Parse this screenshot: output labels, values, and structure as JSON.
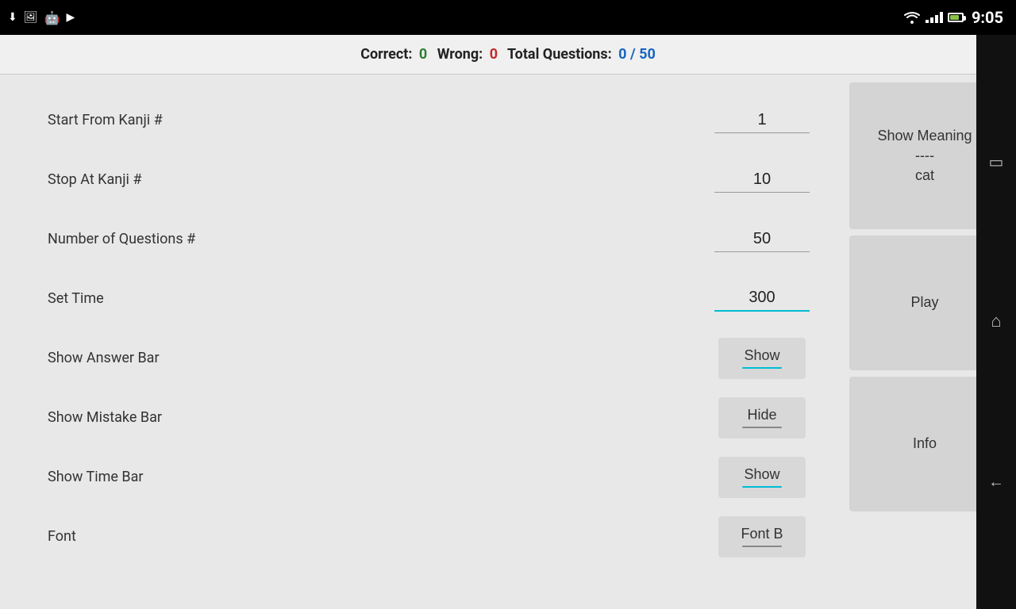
{
  "statusBar": {
    "time": "9:05",
    "icons": [
      "download",
      "image",
      "android",
      "play"
    ]
  },
  "scoreBar": {
    "label_correct": "Correct:",
    "value_correct": "0",
    "label_wrong": "Wrong:",
    "value_wrong": "0",
    "label_total": "Total Questions:",
    "value_total": "0 / 50"
  },
  "form": {
    "rows": [
      {
        "id": "start-kanji",
        "label": "Start From Kanji #",
        "type": "text",
        "value": "1",
        "active": false
      },
      {
        "id": "stop-kanji",
        "label": "Stop At Kanji #",
        "type": "text",
        "value": "10",
        "active": false
      },
      {
        "id": "num-questions",
        "label": "Number of Questions #",
        "type": "text",
        "value": "50",
        "active": false
      },
      {
        "id": "set-time",
        "label": "Set Time",
        "type": "text",
        "value": "300",
        "active": true
      },
      {
        "id": "show-answer",
        "label": "Show Answer Bar",
        "type": "toggle",
        "value": "Show",
        "underline": "blue"
      },
      {
        "id": "show-mistake",
        "label": "Show Mistake Bar",
        "type": "toggle",
        "value": "Hide",
        "underline": "gray"
      },
      {
        "id": "show-time",
        "label": "Show Time Bar",
        "type": "toggle",
        "value": "Show",
        "underline": "blue"
      },
      {
        "id": "font",
        "label": "Font",
        "type": "toggle",
        "value": "Font B",
        "underline": "gray"
      }
    ]
  },
  "sideButtons": {
    "showMeaning": {
      "label": "Show Meaning",
      "separator": "----",
      "sub": "cat"
    },
    "play": {
      "label": "Play"
    },
    "info": {
      "label": "Info"
    }
  },
  "navBar": {
    "back": "←",
    "home": "⌂",
    "menu": "▭"
  }
}
